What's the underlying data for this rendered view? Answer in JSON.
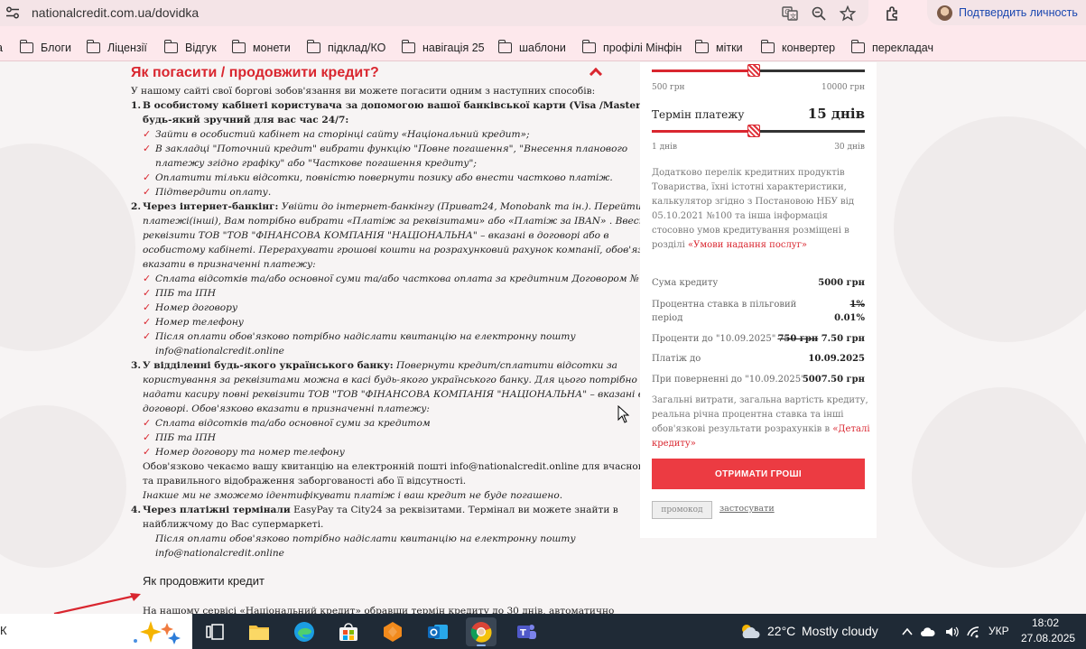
{
  "browser": {
    "url": "nationalcredit.com.ua/dovidka",
    "profile_label": "Подтвердить личность",
    "bookmarks": [
      {
        "label": "Блоги"
      },
      {
        "label": "Ліцензії"
      },
      {
        "label": "Відгук"
      },
      {
        "label": "монети"
      },
      {
        "label": "підклад/КО"
      },
      {
        "label": "навігація 25"
      },
      {
        "label": "шаблони"
      },
      {
        "label": "профілі Мінфін"
      },
      {
        "label": "мітки"
      },
      {
        "label": "конвертер"
      },
      {
        "label": "перекладач"
      }
    ]
  },
  "article": {
    "heading": "Як погасити / продовжити кредит?",
    "intro": "У нашому сайті свої боргові зобов'язання ви можете погасити одним з наступних способів:",
    "m1_title_a": "В особистому кабінеті користувача за допомогою вашої банківської карти (Visa /MasterCard) в",
    "m1_title_b": "будь-який зручний для вас час 24/7:",
    "m1_items": [
      "Зайти в особистий кабінет на сторінці сайту «Національний кредит»;",
      "В закладці \"Поточний кредит\" вибрати функцію \"Повне погашення\", \"Внесення планового",
      "платежу згідно графіку\" або \"Часткове погашення кредиту\";",
      "Оплатити тільки відсотки, повністю повернути позику або внести частково платіж.",
      "Підтвердити оплату."
    ],
    "m2_title": "Через інтернет-банкінг:",
    "m2_lines": [
      "Увійти до інтернет-банкінгу (Приват24, Monobank та ін.). Перейти в розділ",
      "платежі(інші), Вам потрібно вибрати «Платіж за реквізитами» або «Платіж за IBAN» . Ввести",
      "реквізити ТОВ \"ТОВ \"ФІНАНСОВА КОМПАНІЯ \"НАЦІОНАЛЬНА\" – вказані в договорі або в",
      "особистому кабінеті. Перерахувати грошові кошти на розрахунковий рахунок компанії, обов'язково",
      "вказати в призначенні платежу:"
    ],
    "m2_items": [
      "Сплата відсотків та/або основної суми та/або часткова оплата за кредитним Договором №",
      "ПІБ та ІПН",
      "Номер договору",
      "Номер телефону",
      "Після оплати обов'язково потрібно надіслати квитанцію на електронну пошту",
      "info@nationalcredit.online"
    ],
    "m3_title": "У відділенні будь-якого українського банку:",
    "m3_lines": [
      "Повернути кредит/сплатити відсотки за",
      "користування за реквізитами можна в касі будь-якого українського банку. Для цього потрібно",
      "надати касиру повні реквізити ТОВ \"ТОВ \"ФІНАНСОВА КОМПАНІЯ \"НАЦІОНАЛЬНА\" – вказані в",
      "договорі. Обов'язково вказати в призначенні платежу:"
    ],
    "m3_items": [
      "Сплата відсотків та/або основної суми за кредитом",
      "ПІБ та ІПН",
      "Номер договору та номер телефону"
    ],
    "m3_after": [
      "Обов'язково чекаємо вашу квитанцію на електронній пошті info@nationalcredit.online для вчасного",
      "та правильного відображення заборгованості або її відсутності.",
      "Інакше ми не зможемо ідентифікувати платіж і ваш кредит не буде погашено."
    ],
    "m4_title": "Через платіжні термінали",
    "m4_lines": [
      "EasyPay та City24 за реквізитами. Термінал ви можете знайти в",
      "найближчому до Вас супермаркеті."
    ],
    "m4_note": [
      "Після оплати обов'язково потрібно надіслати квитанцію на електронну пошту",
      "info@nationalcredit.online"
    ],
    "subheading": "Як продовжити кредит",
    "last_line": "На нашому сервісі «Національний кредит» обравши термін кредиту до 30 днів, автоматично"
  },
  "calculator": {
    "amount_min": "500 грн",
    "amount_max": "10000 грн",
    "amount_fill": 0.48,
    "term_label": "Термін платежу",
    "term_value": "15 днів",
    "term_min": "1 днів",
    "term_max": "30 днів",
    "term_fill": 0.48,
    "info_lines": [
      "Додатково перелік кредитних продуктів",
      "Товариства, їхні істотні характеристики,",
      "калькулятор згідно з Постановою НБУ від",
      "05.10.2021 №100 та інша інформація",
      "стосовно умов кредитування розміщені в"
    ],
    "info_tail": "розділі",
    "info_link": "«Умови надання послуг»",
    "rows": {
      "sum_label": "Сума кредиту",
      "sum_value": "5000 грн",
      "rate_label_a": "Процентна ставка в пільговий",
      "rate_label_b": "період",
      "rate_old": "1%",
      "rate_new": "0.01%",
      "interest_label": "Проценти до \"10.09.2025\"",
      "interest_old": "750 грн",
      "interest_new": "7.50 грн",
      "pay_label": "Платіж до",
      "pay_value": "10.09.2025",
      "return_label": "При поверненні до \"10.09.2025\"",
      "return_value": "5007.50 грн"
    },
    "costs_lines": [
      "Загальні витрати, загальна вартість кредиту,",
      "реальна річна процентна ставка та інші"
    ],
    "costs_line3": "обов'язкові результати розрахунків в",
    "costs_link_a": "«Деталі",
    "costs_link_b": "кредиту»",
    "cta": "ОТРИМАТИ ГРОШІ",
    "promo": "промокод",
    "apply": "застосувати"
  },
  "taskbar": {
    "left_text": "К",
    "temperature": "22°C",
    "weather": "Mostly cloudy",
    "language": "УКР",
    "time": "18:02",
    "date": "27.08.2025"
  }
}
